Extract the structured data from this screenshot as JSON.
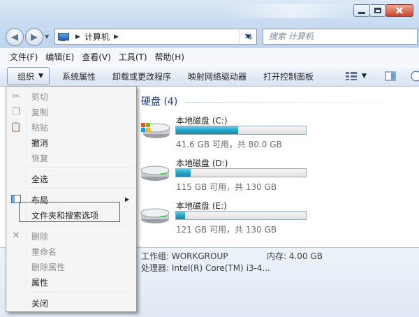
{
  "window": {
    "address": {
      "path_item": "计算机"
    },
    "search": {
      "placeholder": "搜索 计算机"
    }
  },
  "menubar": [
    {
      "label": "文件(F)"
    },
    {
      "label": "编辑(E)"
    },
    {
      "label": "查看(V)"
    },
    {
      "label": "工具(T)"
    },
    {
      "label": "帮助(H)"
    }
  ],
  "toolbar": {
    "organize": "组织",
    "items": [
      {
        "label": "系统属性"
      },
      {
        "label": "卸载或更改程序"
      },
      {
        "label": "映射网络驱动器"
      },
      {
        "label": "打开控制面板"
      }
    ]
  },
  "content": {
    "group_title": "硬盘 (4)",
    "drives": [
      {
        "name": "本地磁盘 (C:)",
        "stats": "41.6 GB 可用，共 80.0 GB",
        "used_fraction": 0.48,
        "icon": "windows-drive-icon"
      },
      {
        "name": "本地磁盘 (D:)",
        "stats": "115 GB 可用，共 130 GB",
        "used_fraction": 0.115,
        "icon": "hard-drive-icon"
      },
      {
        "name": "本地磁盘 (E:)",
        "stats": "121 GB 可用，共 130 GB",
        "used_fraction": 0.07,
        "icon": "hard-drive-icon"
      }
    ]
  },
  "details": {
    "workgroup": "工作组: WORKGROUP",
    "memory": "内存: 4.00 GB",
    "processor": "处理器: Intel(R) Core(TM) i3-4..."
  },
  "menu": {
    "cut": "剪切",
    "copy": "复制",
    "paste": "粘贴",
    "undo": "撤消",
    "redo": "恢复",
    "select_all": "全选",
    "layout": "布局",
    "folder_options": "文件夹和搜索选项",
    "delete": "删除",
    "rename": "重命名",
    "remove_props": "删除属性",
    "properties": "属性",
    "close": "关闭"
  },
  "colors": {
    "highlight_box": "#d62c2c",
    "progress_fill": "#26a3c8",
    "group_title": "#1e3a8a"
  }
}
